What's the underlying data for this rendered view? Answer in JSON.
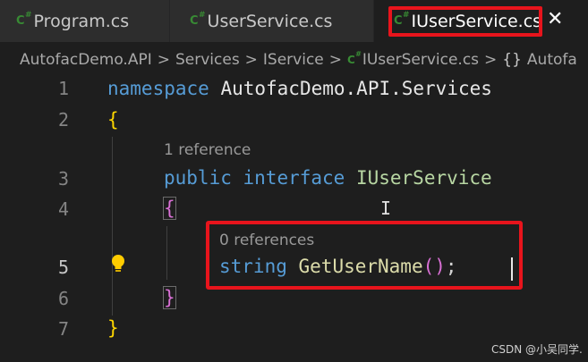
{
  "tabs": [
    {
      "icon": "csharp-file-icon",
      "badge": "C",
      "label": "Program.cs"
    },
    {
      "icon": "csharp-file-icon",
      "badge": "C",
      "label": "UserService.cs"
    },
    {
      "icon": "csharp-file-icon",
      "badge": "C",
      "label": "IUserService.cs",
      "active": true
    }
  ],
  "tab_close_glyph": "✕",
  "breadcrumb": {
    "items": [
      "AutofacDemo.API",
      "Services",
      "IService",
      "IUserService.cs",
      "Autofa"
    ],
    "separator": ">",
    "brace_glyph": "{}"
  },
  "editor": {
    "line_numbers": [
      "1",
      "2",
      "3",
      "4",
      "5",
      "6",
      "7"
    ],
    "codelens": [
      "1 reference",
      "0 references"
    ],
    "tokens": {
      "namespace_kw": "namespace",
      "namespace_name": "AutofacDemo.API.Services",
      "open_brace": "{",
      "close_brace": "}",
      "public_kw": "public",
      "interface_kw": "interface",
      "interface_name": "IUserService",
      "string_kw": "string",
      "method_name": "GetUserName",
      "parens": "()",
      "semicolon": ";"
    },
    "cursor_glyph": "I"
  },
  "watermark": "CSDN @小吴同学.",
  "colors": {
    "highlight_box": "#e8141c",
    "keyword": "#569cd6",
    "interface": "#b8d7a3",
    "method": "#dcdcaa",
    "brace_gold": "#ffd700",
    "brace_pink": "#da70d6",
    "csharp_icon": "#388a34"
  }
}
